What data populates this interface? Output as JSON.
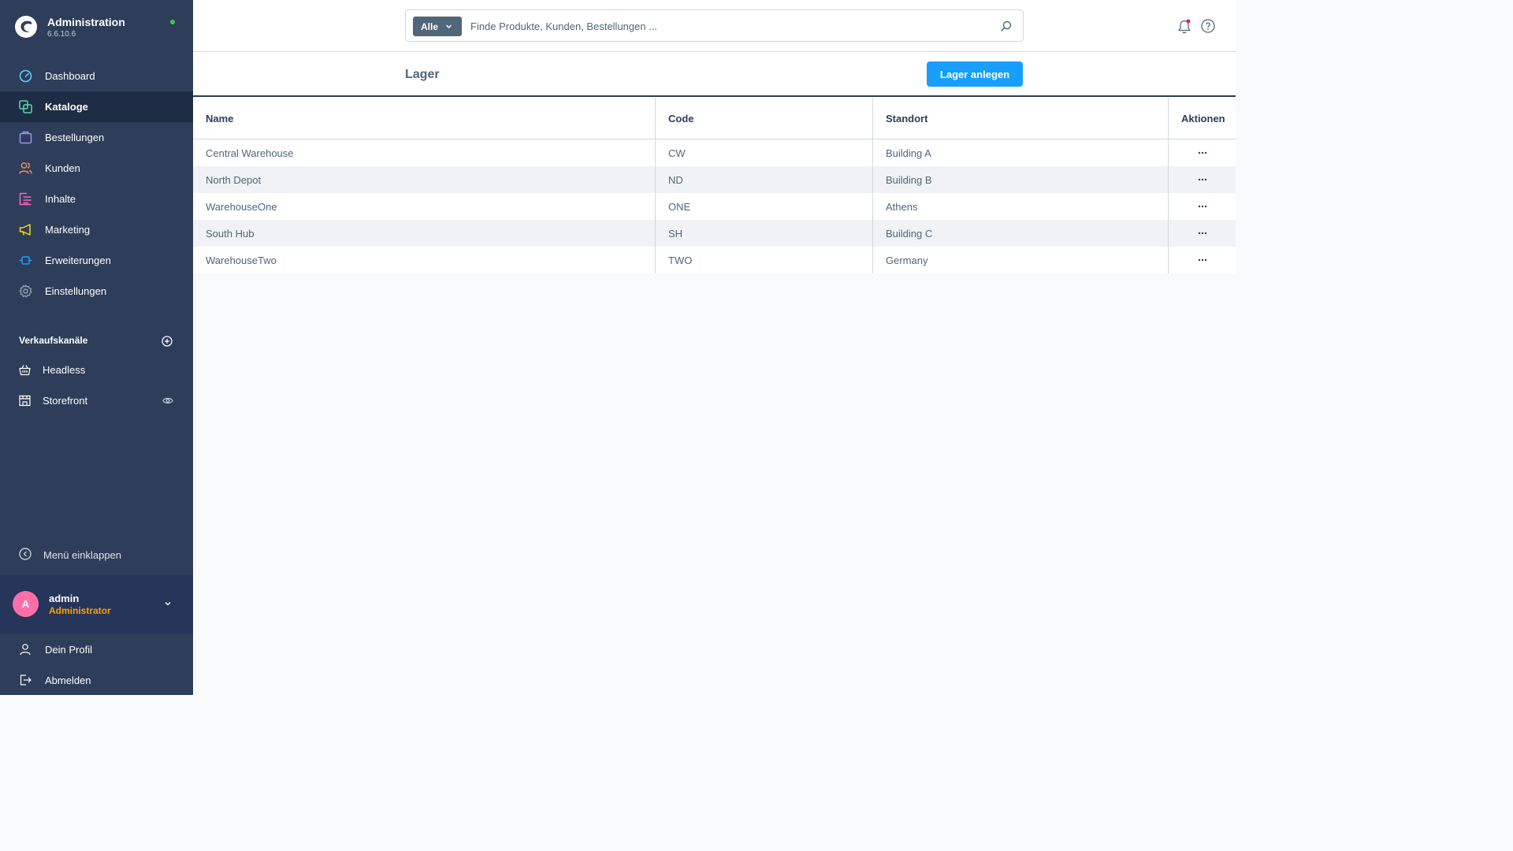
{
  "brand": {
    "title": "Administration",
    "version": "6.6.10.6"
  },
  "nav": [
    {
      "label": "Dashboard",
      "icon": "dashboard-icon",
      "color": "#57d9ff"
    },
    {
      "label": "Kataloge",
      "icon": "catalog-icon",
      "color": "#57d9a3",
      "active": true
    },
    {
      "label": "Bestellungen",
      "icon": "orders-icon",
      "color": "#a092f0"
    },
    {
      "label": "Kunden",
      "icon": "customers-icon",
      "color": "#f88962"
    },
    {
      "label": "Inhalte",
      "icon": "content-icon",
      "color": "#ff68b4"
    },
    {
      "label": "Marketing",
      "icon": "marketing-icon",
      "color": "#ffd700"
    },
    {
      "label": "Erweiterungen",
      "icon": "extensions-icon",
      "color": "#189eff"
    },
    {
      "label": "Einstellungen",
      "icon": "settings-icon",
      "color": "#9aa8b5"
    }
  ],
  "sales_channels": {
    "title": "Verkaufskanäle",
    "items": [
      {
        "label": "Headless"
      },
      {
        "label": "Storefront"
      }
    ]
  },
  "collapse_label": "Menü einklappen",
  "user": {
    "initial": "A",
    "name": "admin",
    "role": "Administrator"
  },
  "footer": [
    {
      "label": "Dein Profil"
    },
    {
      "label": "Abmelden"
    }
  ],
  "search": {
    "type_label": "Alle",
    "placeholder": "Finde Produkte, Kunden, Bestellungen ..."
  },
  "page": {
    "title": "Lager",
    "primary_button": "Lager anlegen"
  },
  "table": {
    "columns": [
      "Name",
      "Code",
      "Standort",
      "Aktionen"
    ],
    "rows": [
      [
        "Central Warehouse",
        "CW",
        "Building A"
      ],
      [
        "North Depot",
        "ND",
        "Building B"
      ],
      [
        "WarehouseOne",
        "ONE",
        "Athens"
      ],
      [
        "South Hub",
        "SH",
        "Building C"
      ],
      [
        "WarehouseTwo",
        "TWO",
        "Germany"
      ]
    ]
  },
  "colors": {
    "sidebar": "#2d3d5a",
    "primary": "#189eff",
    "user_role": "#ffa100",
    "avatar": "#ff6ea8",
    "status_dot": "#37d046"
  }
}
